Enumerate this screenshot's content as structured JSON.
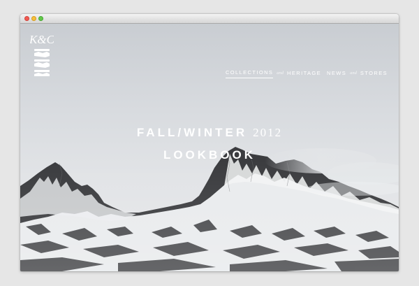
{
  "window": {
    "controls": [
      "close-button",
      "minimize-button",
      "zoom-button"
    ]
  },
  "brand": {
    "monogram": "K&C"
  },
  "nav": {
    "items": [
      {
        "label": "Collections",
        "active": true
      },
      {
        "label": "Heritage",
        "active": false
      },
      {
        "label": "News",
        "active": false
      },
      {
        "label": "Stores",
        "active": false
      }
    ],
    "separator": "and"
  },
  "hero": {
    "title_main": "FALL/WINTER",
    "title_year": "2012",
    "subtitle": "LOOKBOOK"
  },
  "colors": {
    "sky": "#d8dbdf",
    "rock": "#3a3b3e",
    "snow": "#f2f3f4",
    "text": "#ffffff"
  }
}
